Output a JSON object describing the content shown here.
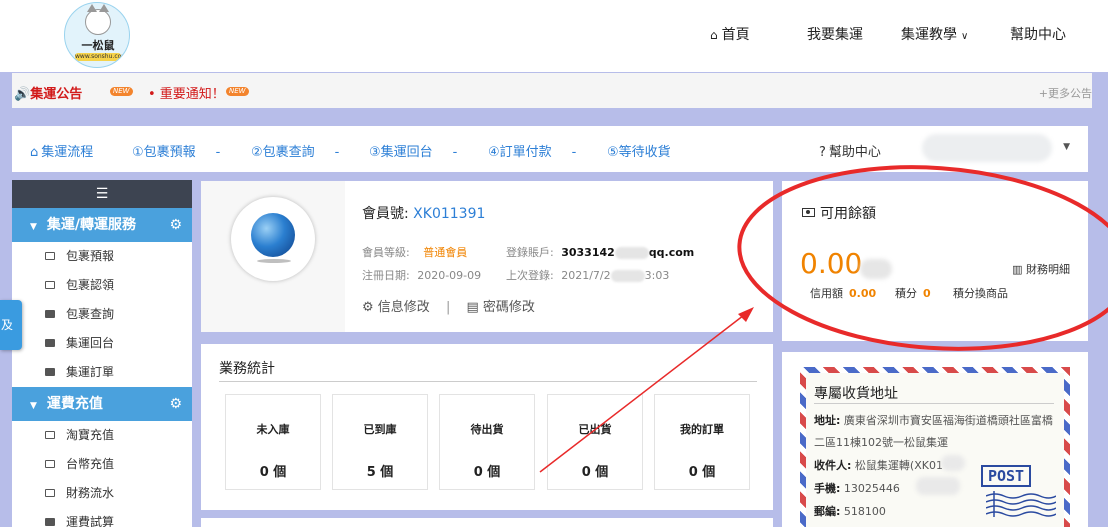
{
  "header": {
    "logo_text": "一松鼠",
    "logo_sub": "www.sonshu.com",
    "nav": {
      "home": "首頁",
      "ship": "我要集運",
      "tutorial": "集運教學",
      "help": "幫助中心"
    }
  },
  "notice": {
    "announcement": "集運公告",
    "new_badge": "NEW",
    "important": "• 重要通知！",
    "more": "+更多公告"
  },
  "steps": {
    "items": [
      "集運流程",
      "①包裹預報",
      "②包裹查詢",
      "③集運回台",
      "④訂單付款",
      "⑤等待收貨"
    ],
    "separator": "-",
    "help": "幫助中心"
  },
  "sidebar": {
    "menu_icon": "☰",
    "group1": {
      "label": "集運/轉運服務",
      "items": [
        "包裹預報",
        "包裹認領",
        "包裹查詢",
        "集運回台",
        "集運訂單"
      ]
    },
    "group2": {
      "label": "運費充值",
      "items": [
        "淘寶充值",
        "台幣充值",
        "財務流水",
        "運費試算"
      ]
    },
    "side_tab": "及"
  },
  "member": {
    "id_label": "會員號:",
    "id_value": "XK011391",
    "level_label": "會員等級:",
    "level_value": "普通會員",
    "account_label": "登錄賬戶:",
    "account_prefix": "3033142",
    "account_suffix": "qq.com",
    "reg_label": "注冊日期:",
    "reg_value": "2020-09-09",
    "last_label": "上次登錄:",
    "last_prefix": "2021/7/2",
    "last_suffix": "3:03",
    "edit_info": "信息修改",
    "edit_pwd": "密碼修改",
    "divider": "|"
  },
  "balance": {
    "title": "可用餘額",
    "amount": "0.00",
    "finance": "財務明細",
    "credit_label": "信用額",
    "credit_value": "0.00",
    "points_label": "積分",
    "points_value": "0",
    "redeem": "積分換商品"
  },
  "stats": {
    "title": "業務統計",
    "boxes": [
      {
        "label": "未入庫",
        "value": "0 個"
      },
      {
        "label": "已到庫",
        "value": "5 個"
      },
      {
        "label": "待出貨",
        "value": "0 個"
      },
      {
        "label": "已出貨",
        "value": "0 個"
      },
      {
        "label": "我的訂單",
        "value": "0 個"
      }
    ]
  },
  "address": {
    "title": "專屬收貨地址",
    "addr_label": "地址:",
    "addr_line1": "廣東省深圳市寶安區福海街道橋頭社區富橋",
    "addr_line2": "二區11棟102號一松鼠集運",
    "recv_label": "收件人:",
    "recv_value": "松鼠集運轉(XK01",
    "phone_label": "手機:",
    "phone_value": "13025446",
    "zip_label": "郵編:",
    "zip_value": "518100",
    "post": "POST"
  },
  "colors": {
    "accent": "#4aa1dd",
    "link": "#2d7fd6",
    "orange": "#f08300",
    "alert_red": "#d21a1a",
    "annotation": "#e82a2a"
  }
}
